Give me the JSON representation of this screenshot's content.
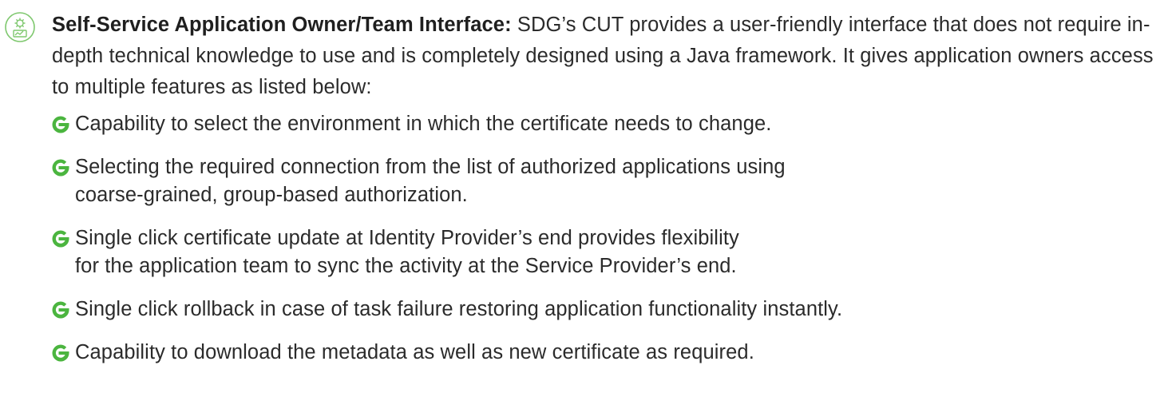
{
  "header": {
    "icon": "gear-dashboard-icon",
    "lead": "Self-Service Application Owner/Team Interface:",
    "body": "SDG’s CUT provides a user-friendly interface that does not require in-depth technical knowledge to use and is completely designed using a Java framework. It gives application owners access to multiple features as listed below:"
  },
  "features": [
    {
      "icon": "green-g-bullet-icon",
      "lines": [
        "Capability to select the environment in which the certificate needs to change."
      ]
    },
    {
      "icon": "green-g-bullet-icon",
      "lines": [
        "Selecting the required connection from the list of authorized applications using",
        "coarse-grained, group-based authorization."
      ]
    },
    {
      "icon": "green-g-bullet-icon",
      "lines": [
        "Single click certificate update at Identity Provider’s end provides flexibility",
        "for the application team to sync the activity at the Service Provider’s end."
      ]
    },
    {
      "icon": "green-g-bullet-icon",
      "lines": [
        "Single click rollback in case of task failure restoring application functionality instantly."
      ]
    },
    {
      "icon": "green-g-bullet-icon",
      "lines": [
        "Capability to download the metadata as well as new certificate as required."
      ]
    }
  ],
  "colors": {
    "accent_green": "#4bb53f",
    "icon_outline": "#6dc15d",
    "text": "#2b2b2b"
  }
}
